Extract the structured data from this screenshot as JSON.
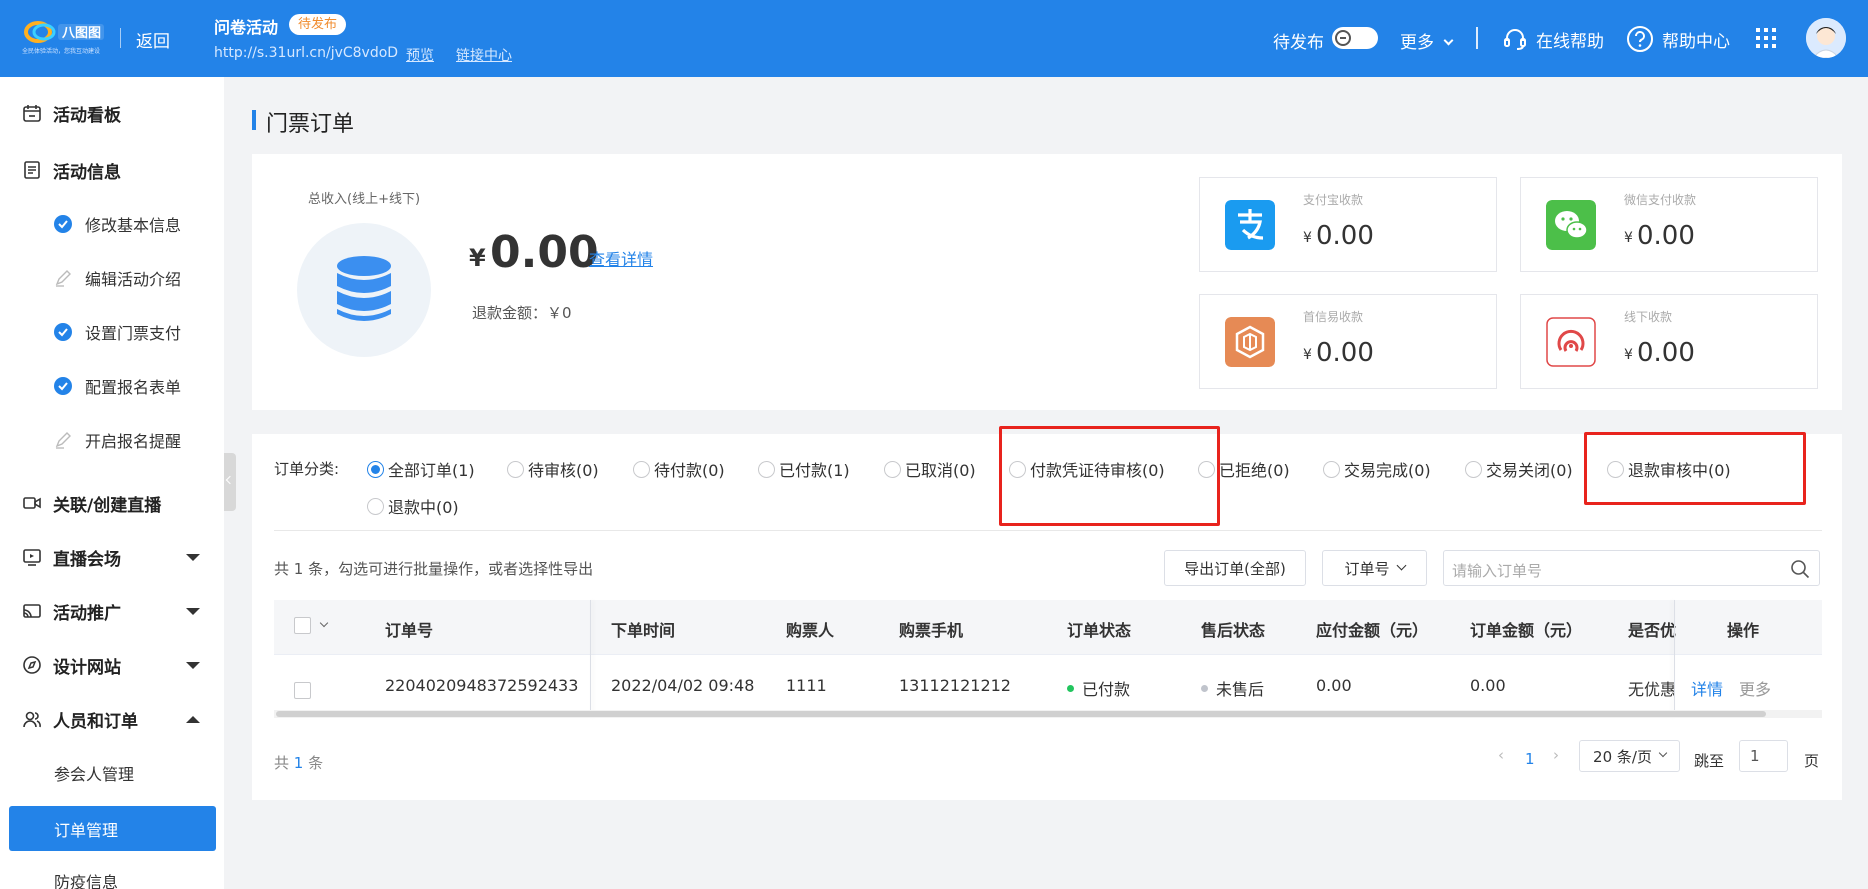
{
  "topbar": {
    "logo_text": "全民体验活动，您我互动建设",
    "back": "返回",
    "title": "问卷活动",
    "badge": "待发布",
    "url": "http://s.31url.cn/jvC8vdoD",
    "preview": "预览",
    "link_center": "链接中心",
    "status_label": "待发布",
    "more": "更多",
    "online_help": "在线帮助",
    "help_center": "帮助中心"
  },
  "sidebar": {
    "items": [
      {
        "label": "活动看板",
        "icon": "calendar-icon"
      },
      {
        "label": "活动信息",
        "icon": "document-icon"
      },
      {
        "label": "修改基本信息",
        "icon": "check-circle-icon"
      },
      {
        "label": "编辑活动介绍",
        "icon": "pencil-icon"
      },
      {
        "label": "设置门票支付",
        "icon": "check-circle-icon"
      },
      {
        "label": "配置报名表单",
        "icon": "check-circle-icon"
      },
      {
        "label": "开启报名提醒",
        "icon": "pencil-icon"
      },
      {
        "label": "关联/创建直播",
        "icon": "video-icon"
      },
      {
        "label": "直播会场",
        "icon": "live-icon"
      },
      {
        "label": "活动推广",
        "icon": "cast-icon"
      },
      {
        "label": "设计网站",
        "icon": "compass-icon"
      },
      {
        "label": "人员和订单",
        "icon": "users-icon"
      },
      {
        "label": "参会人管理"
      },
      {
        "label": "订单管理"
      },
      {
        "label": "防疫信息"
      }
    ]
  },
  "main": {
    "page_title": "门票订单",
    "income": {
      "label": "总收入(线上+线下)",
      "currency": "¥",
      "amount": "0.00",
      "detail_link": "查看详情",
      "refund": "退款金额：￥0"
    },
    "pay_cards": [
      {
        "label": "支付宝收款",
        "currency": "¥",
        "amount": "0.00"
      },
      {
        "label": "微信支付收款",
        "currency": "¥",
        "amount": "0.00"
      },
      {
        "label": "首信易收款",
        "currency": "¥",
        "amount": "0.00"
      },
      {
        "label": "线下收款",
        "currency": "¥",
        "amount": "0.00"
      }
    ],
    "filter": {
      "label": "订单分类:",
      "options": [
        "全部订单(1)",
        "待审核(0)",
        "待付款(0)",
        "已付款(1)",
        "已取消(0)",
        "付款凭证待审核(0)",
        "已拒绝(0)",
        "交易完成(0)",
        "交易关闭(0)",
        "退款审核中(0)",
        "退款中(0)"
      ],
      "selected": "全部订单(1)"
    },
    "toolbar": {
      "count_info": "共 1 条，勾选可进行批量操作，或者选择性导出",
      "export": "导出订单(全部)",
      "search_field": "订单号",
      "search_placeholder": "请输入订单号"
    },
    "table": {
      "columns": [
        "订单号",
        "下单时间",
        "购票人",
        "购票手机",
        "订单状态",
        "售后状态",
        "应付金额（元）",
        "订单金额（元）",
        "是否优",
        "操作"
      ],
      "rows": [
        {
          "order_no": "2204020948372592433",
          "time": "2022/04/02 09:48",
          "buyer": "1111",
          "phone": "13112121212",
          "status": "已付款",
          "after_sale": "未售后",
          "payable": "0.00",
          "amount": "0.00",
          "discount": "无优惠",
          "action_detail": "详情",
          "action_more": "更多"
        }
      ]
    },
    "pagination": {
      "total_prefix": "共",
      "total": "1",
      "total_suffix": "条",
      "current_page": "1",
      "page_size": "20 条/页",
      "jump_label": "跳至",
      "jump_value": "1",
      "page_suffix": "页"
    }
  },
  "colors": {
    "primary": "#2383e8",
    "highlight": "#e8231d",
    "status_paid": "#22c55e"
  }
}
